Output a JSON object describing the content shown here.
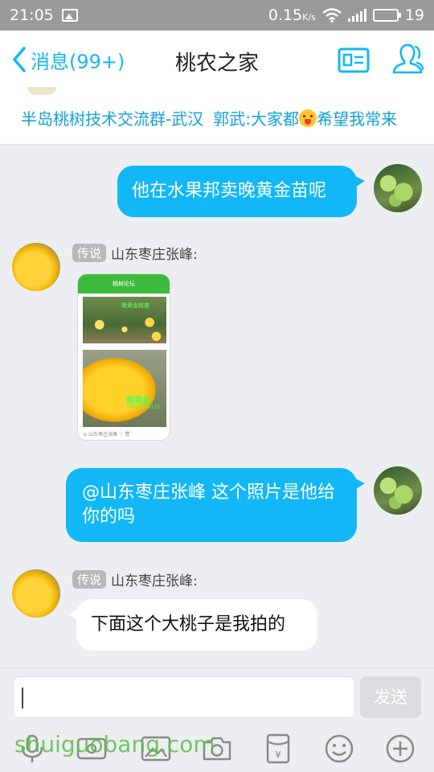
{
  "status_bar": {
    "time": "21:05",
    "speed": "0.15",
    "speed_unit": "K/s",
    "battery": "19"
  },
  "header": {
    "back_label": "消息(99+)",
    "title": "桃农之家"
  },
  "banner": {
    "group_name": "半岛桃树技术交流群-武汉",
    "notice": "郭武:大家都",
    "notice_tail": "希望我常来"
  },
  "messages": [
    {
      "direction": "out",
      "text": "他在水果邦卖晚黄金苗呢"
    },
    {
      "direction": "in",
      "badge": "传说",
      "sender": "山东枣庄张峰:",
      "image": {
        "header": "桃树论坛",
        "top_caption": "晚黄金桃苗",
        "big_caption": "晚黄金",
        "big_number": "13906328175",
        "footer": "◎ 山东枣庄张峰    ♡ 赞"
      }
    },
    {
      "direction": "out",
      "text": "@山东枣庄张峰 这个照片是他给你的吗"
    },
    {
      "direction": "in",
      "badge": "传说",
      "sender": "山东枣庄张峰:",
      "text": "下面这个大桃子是我拍的"
    }
  ],
  "input": {
    "value": "",
    "send_label": "发送"
  },
  "watermark": "shuiguobang.com",
  "colors": {
    "accent": "#12b7f5",
    "status_bar": "#9a9a9a",
    "banner_text": "#12a0d6",
    "background": "#eceef1"
  }
}
